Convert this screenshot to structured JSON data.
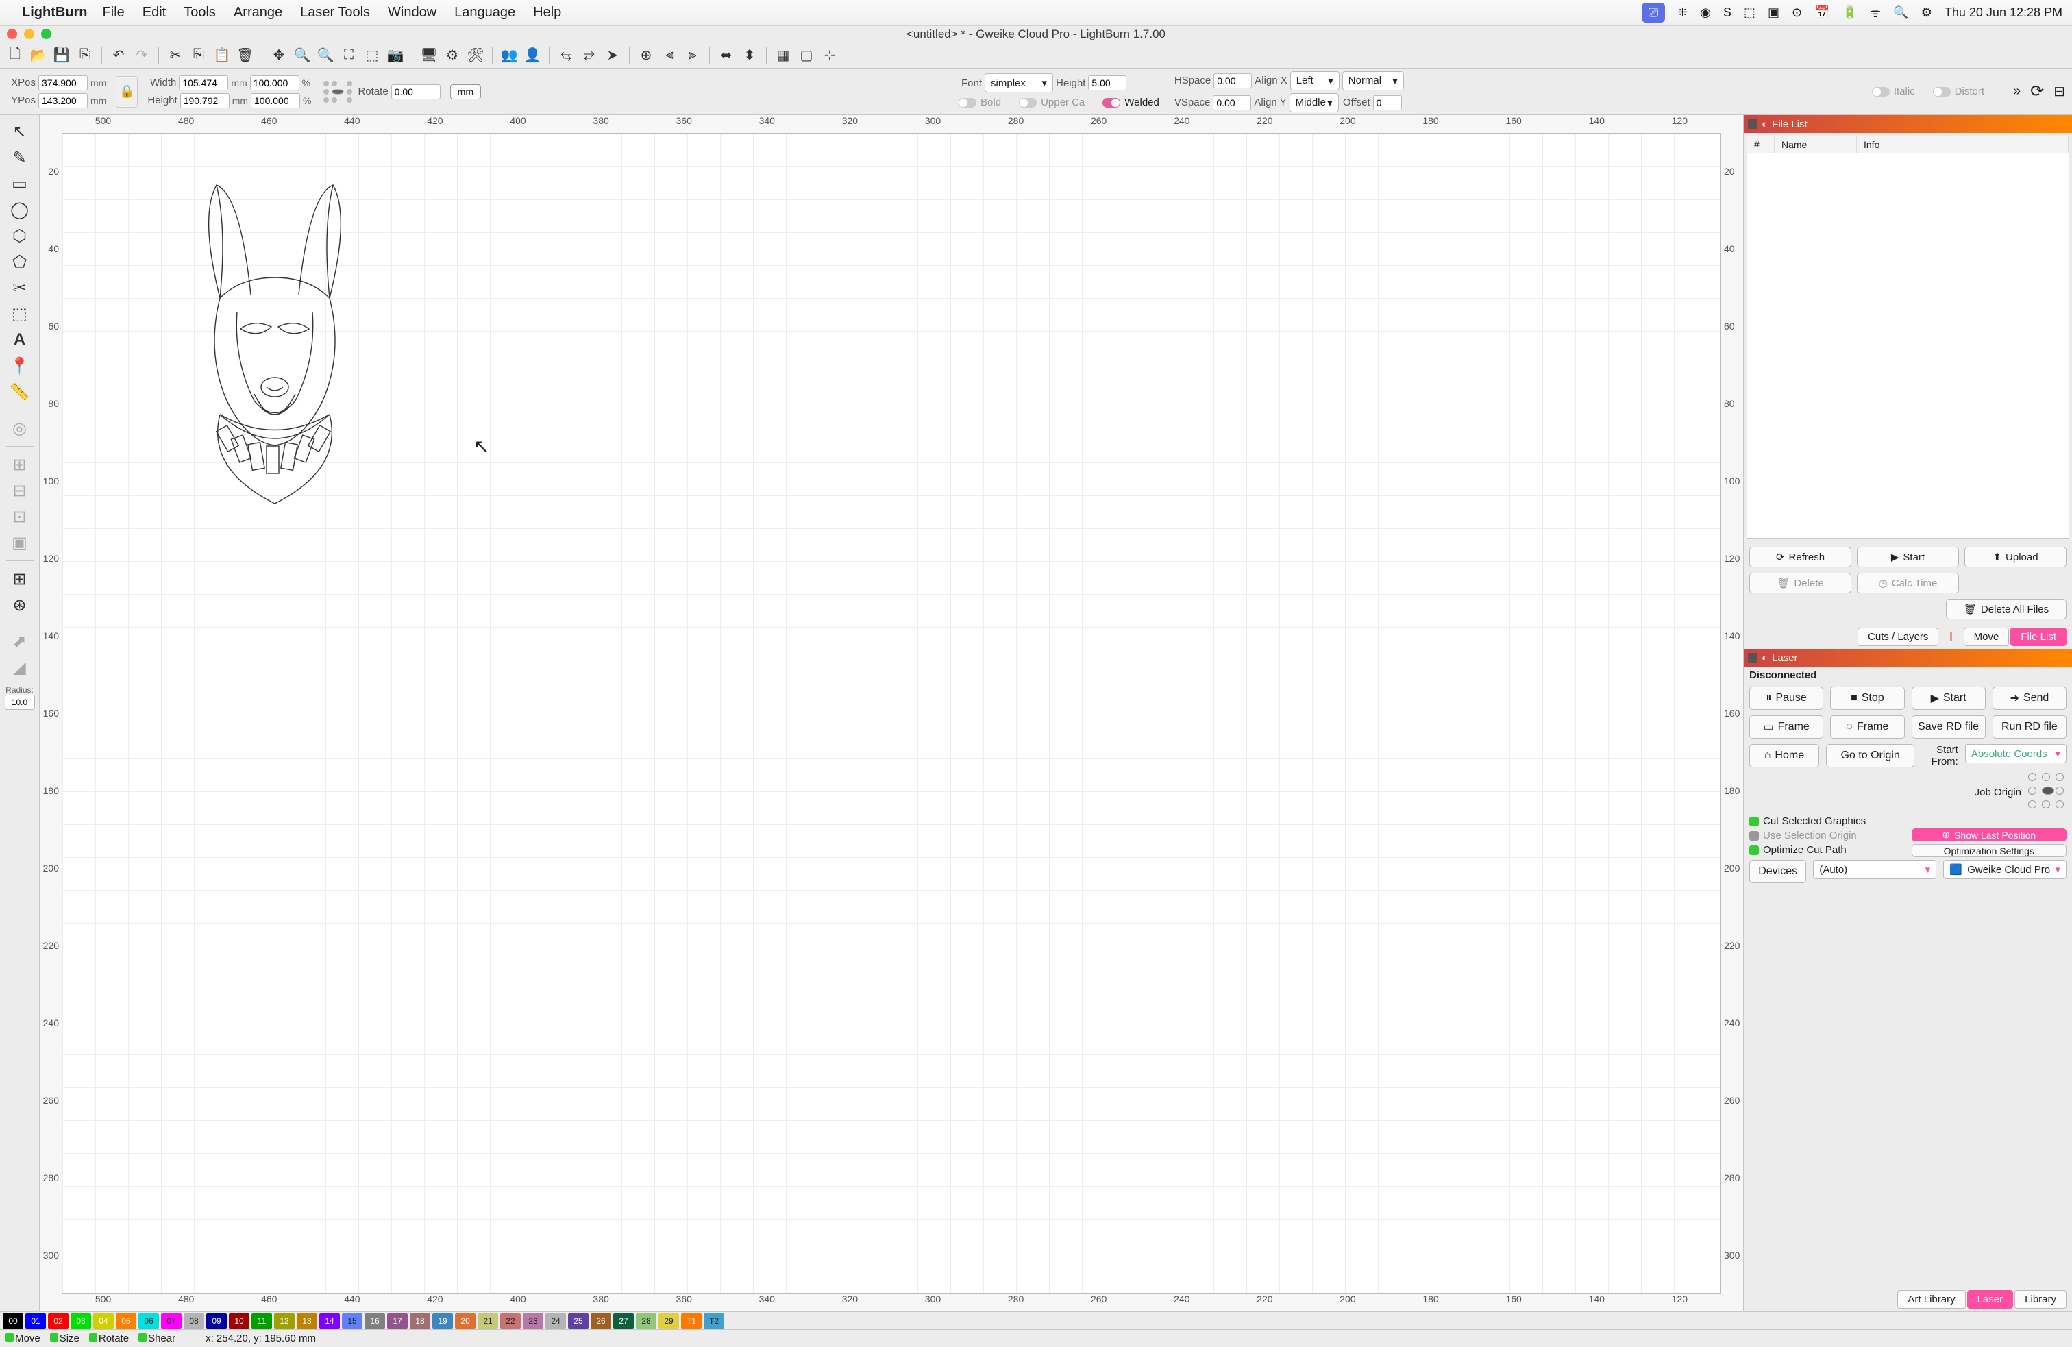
{
  "menubar": {
    "app": "LightBurn",
    "items": [
      "File",
      "Edit",
      "Tools",
      "Arrange",
      "Laser Tools",
      "Window",
      "Language",
      "Help"
    ],
    "clock": "Thu 20 Jun  12:28 PM"
  },
  "titlebar": "<untitled> * - Gweike Cloud Pro - LightBurn 1.7.00",
  "props": {
    "xpos_label": "XPos",
    "xpos": "374.900",
    "xpos_unit": "mm",
    "ypos_label": "YPos",
    "ypos": "143.200",
    "ypos_unit": "mm",
    "width_label": "Width",
    "width": "105.474",
    "width_unit": "mm",
    "width_pct": "100.000",
    "pct": "%",
    "height_label": "Height",
    "height": "190.792",
    "height_unit": "mm",
    "height_pct": "100.000",
    "rotate_label": "Rotate",
    "rotate": "0.00",
    "mm_btn": "mm",
    "font_label": "Font",
    "font": "simplex",
    "fheight_label": "Height",
    "fheight": "5.00",
    "hspace_label": "HSpace",
    "hspace": "0.00",
    "vspace_label": "VSpace",
    "vspace": "0.00",
    "alignx_label": "Align X",
    "alignx": "Left",
    "aligny_label": "Align Y",
    "aligny": "Middle",
    "normal": "Normal",
    "offset_label": "Offset",
    "offset": "0",
    "bold": "Bold",
    "italic": "Italic",
    "upper": "Upper Ca",
    "distort": "Distort",
    "welded": "Welded"
  },
  "ruler_h": [
    "500",
    "480",
    "460",
    "440",
    "420",
    "400",
    "380",
    "360",
    "340",
    "320",
    "300",
    "280",
    "260",
    "240",
    "220",
    "200",
    "180",
    "160",
    "140",
    "120"
  ],
  "ruler_v": [
    "20",
    "40",
    "60",
    "80",
    "100",
    "120",
    "140",
    "160",
    "180",
    "200",
    "220",
    "240",
    "260",
    "280",
    "300"
  ],
  "filelist": {
    "title": "File List",
    "cols": {
      "num": "#",
      "name": "Name",
      "info": "Info"
    },
    "refresh": "Refresh",
    "start": "Start",
    "upload": "Upload",
    "delete": "Delete",
    "calc": "Calc Time",
    "deleteall": "Delete All Files"
  },
  "tabs": {
    "cuts": "Cuts / Layers",
    "move": "Move",
    "filelist": "File List"
  },
  "laser": {
    "title": "Laser",
    "status": "Disconnected",
    "pause": "Pause",
    "stop": "Stop",
    "start": "Start",
    "send": "Send",
    "frame1": "Frame",
    "frame2": "Frame",
    "saverd": "Save RD file",
    "runrd": "Run RD file",
    "home": "Home",
    "origin": "Go to Origin",
    "startfrom": "Start From:",
    "abs": "Absolute Coords",
    "joborigin": "Job Origin",
    "cutsel": "Cut Selected Graphics",
    "usesel": "Use Selection Origin",
    "optpath": "Optimize Cut Path",
    "showlast": "Show Last Position",
    "optset": "Optimization Settings",
    "devices": "Devices",
    "auto": "(Auto)",
    "device": "Gweike Cloud Pro"
  },
  "tabs2": {
    "art": "Art Library",
    "laser": "Laser",
    "library": "Library"
  },
  "colors": [
    {
      "n": "00",
      "c": "#000000"
    },
    {
      "n": "01",
      "c": "#0000ff"
    },
    {
      "n": "02",
      "c": "#ff0000"
    },
    {
      "n": "03",
      "c": "#00e000"
    },
    {
      "n": "04",
      "c": "#d0d000"
    },
    {
      "n": "05",
      "c": "#ff8000"
    },
    {
      "n": "06",
      "c": "#00e0e0"
    },
    {
      "n": "07",
      "c": "#ff00ff"
    },
    {
      "n": "08",
      "c": "#b4b4b4"
    },
    {
      "n": "09",
      "c": "#0000a0"
    },
    {
      "n": "10",
      "c": "#a00000"
    },
    {
      "n": "11",
      "c": "#00a000"
    },
    {
      "n": "12",
      "c": "#a0a000"
    },
    {
      "n": "13",
      "c": "#c08000"
    },
    {
      "n": "14",
      "c": "#8000ff"
    },
    {
      "n": "15",
      "c": "#6080ff"
    },
    {
      "n": "16",
      "c": "#808080"
    },
    {
      "n": "17",
      "c": "#95538c"
    },
    {
      "n": "18",
      "c": "#a07070"
    },
    {
      "n": "19",
      "c": "#3d87c0"
    },
    {
      "n": "20",
      "c": "#e07030"
    },
    {
      "n": "21",
      "c": "#c5c878"
    },
    {
      "n": "22",
      "c": "#c77373"
    },
    {
      "n": "23",
      "c": "#b878a8"
    },
    {
      "n": "24",
      "c": "#b4b4b4"
    },
    {
      "n": "25",
      "c": "#6040a0"
    },
    {
      "n": "26",
      "c": "#a06020"
    },
    {
      "n": "27",
      "c": "#106040"
    },
    {
      "n": "28",
      "c": "#90c878"
    },
    {
      "n": "29",
      "c": "#e0d040"
    },
    {
      "n": "T1",
      "c": "#ff7800"
    },
    {
      "n": "T2",
      "c": "#40a0d0"
    }
  ],
  "status": {
    "move": "Move",
    "size": "Size",
    "rotate": "Rotate",
    "shear": "Shear",
    "coords": "x: 254.20, y: 195.60 mm"
  },
  "radius": {
    "label": "Radius:",
    "value": "10.0"
  }
}
